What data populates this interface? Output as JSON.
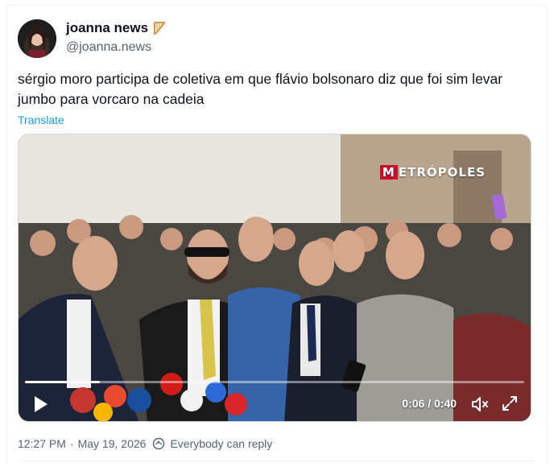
{
  "author": {
    "display_name": "joanna news",
    "handle": "@joanna.news",
    "badge_icon": "harp-icon"
  },
  "tweet": {
    "text": "sérgio moro participa de coletiva em que flávio bolsonaro diz que foi sim levar jumbo para vorcaro na cadeia",
    "translate_label": "Translate"
  },
  "video": {
    "watermark": "METRÓPOLES",
    "current_time": "0:06",
    "duration": "0:40",
    "time_display": "0:06 / 0:40",
    "progress_fraction": 0.15
  },
  "meta": {
    "time": "12:27 PM",
    "date": "May 19, 2026",
    "reply_setting": "Everybody can reply"
  },
  "colors": {
    "accent": "#1d9bf0",
    "text_primary": "#0f1419",
    "text_secondary": "#536471",
    "brand_red": "#c8102e"
  }
}
